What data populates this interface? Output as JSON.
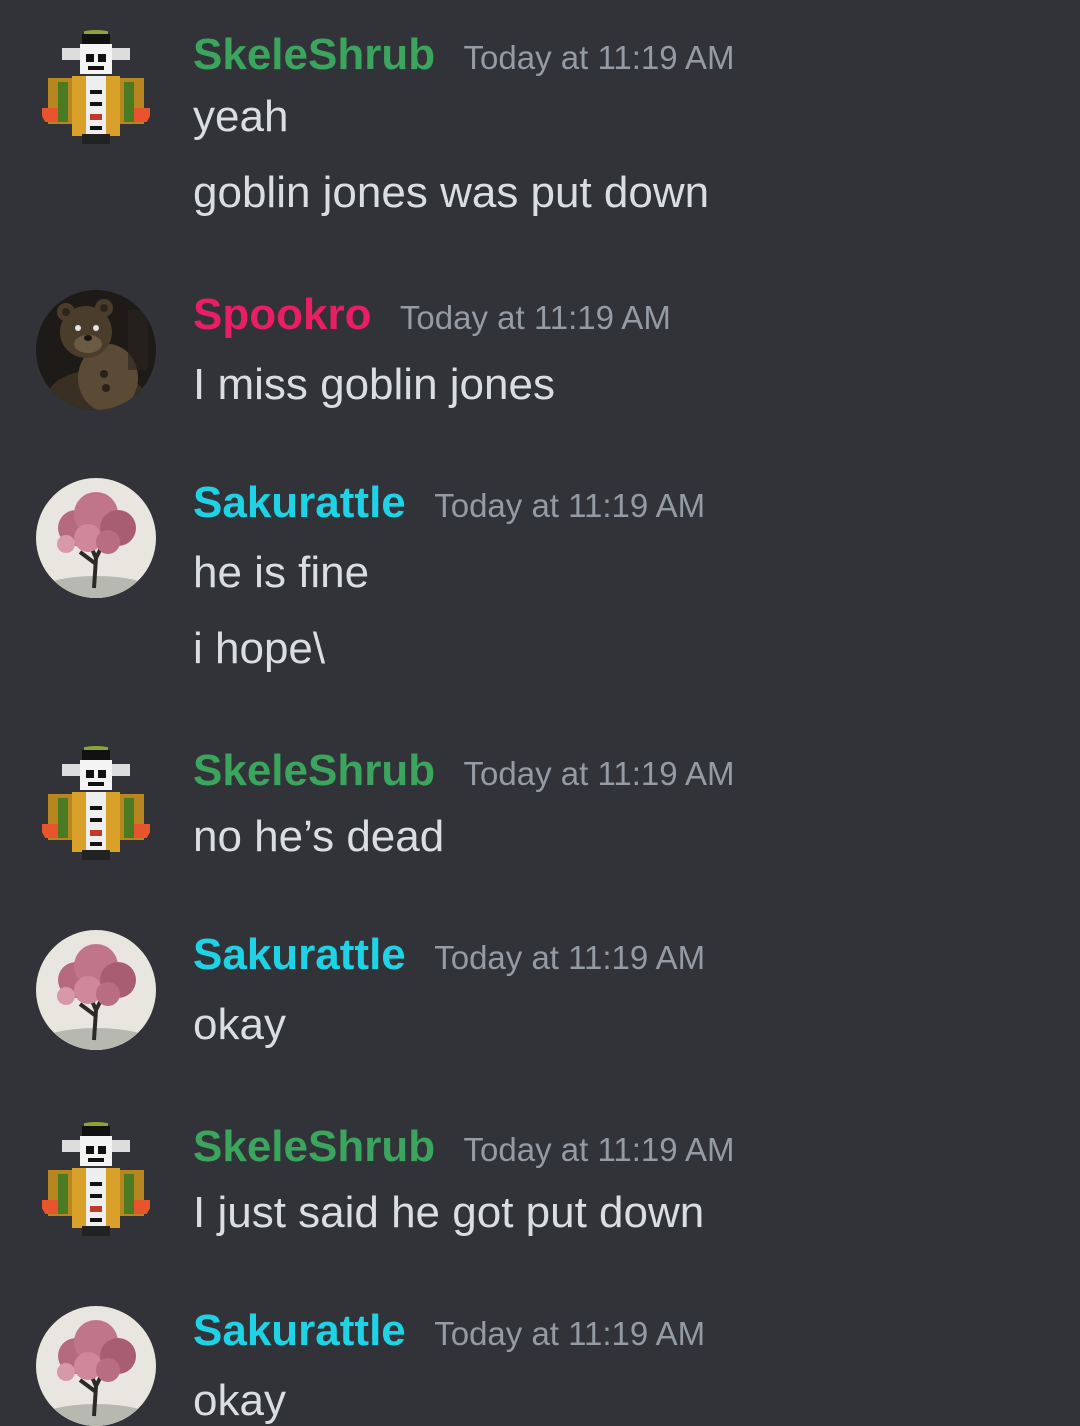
{
  "colors": {
    "background": "#313338",
    "SkeleShrub": "#3ba55d",
    "Spookro": "#e91e63",
    "Sakurattle": "#1fd3e6",
    "timestamp": "#949ba4",
    "text": "#dbdee1"
  },
  "messages": [
    {
      "username": "SkeleShrub",
      "avatar_icon": "pixel-skeleton-avatar-icon",
      "timestamp": "Today at 11:19 AM",
      "lines": [
        "yeah",
        "goblin jones was put down"
      ]
    },
    {
      "username": "Spookro",
      "avatar_icon": "animatronic-bear-avatar-icon",
      "timestamp": "Today at 11:19 AM",
      "lines": [
        "I miss goblin jones"
      ]
    },
    {
      "username": "Sakurattle",
      "avatar_icon": "cherry-blossom-tree-avatar-icon",
      "timestamp": "Today at 11:19 AM",
      "lines": [
        "he is fine",
        "i hope\\"
      ]
    },
    {
      "username": "SkeleShrub",
      "avatar_icon": "pixel-skeleton-avatar-icon",
      "timestamp": "Today at 11:19 AM",
      "lines": [
        "no he’s dead"
      ]
    },
    {
      "username": "Sakurattle",
      "avatar_icon": "cherry-blossom-tree-avatar-icon",
      "timestamp": "Today at 11:19 AM",
      "lines": [
        "okay"
      ]
    },
    {
      "username": "SkeleShrub",
      "avatar_icon": "pixel-skeleton-avatar-icon",
      "timestamp": "Today at 11:19 AM",
      "lines": [
        "I just said he got put down"
      ]
    },
    {
      "username": "Sakurattle",
      "avatar_icon": "cherry-blossom-tree-avatar-icon",
      "timestamp": "Today at 11:19 AM",
      "lines": [
        "okay"
      ]
    }
  ]
}
